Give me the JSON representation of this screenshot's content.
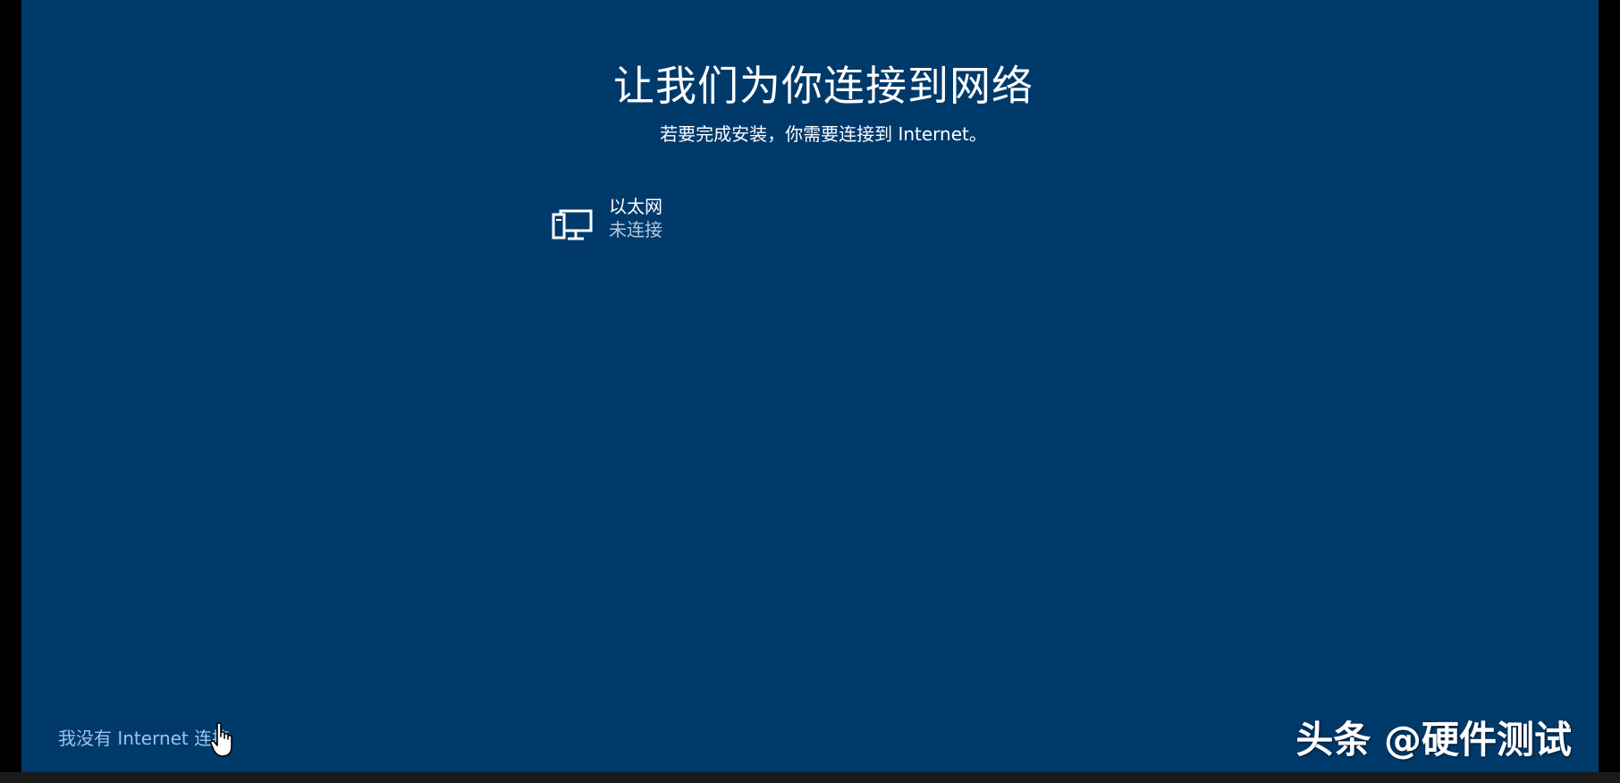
{
  "setup": {
    "title": "让我们为你连接到网络",
    "subtitle": "若要完成安装，你需要连接到 Internet。"
  },
  "networks": [
    {
      "name": "以太网",
      "status": "未连接",
      "icon": "ethernet-icon"
    }
  ],
  "footer": {
    "no_internet_label": "我没有 Internet 连接",
    "cursor_icon": "hand-pointer-icon"
  },
  "watermark": {
    "text": "头条 @硬件测试"
  },
  "colors": {
    "background": "#003a6b",
    "text": "#ffffff",
    "link": "#9cc3ee",
    "secondary_text": "#b8c8dc"
  }
}
